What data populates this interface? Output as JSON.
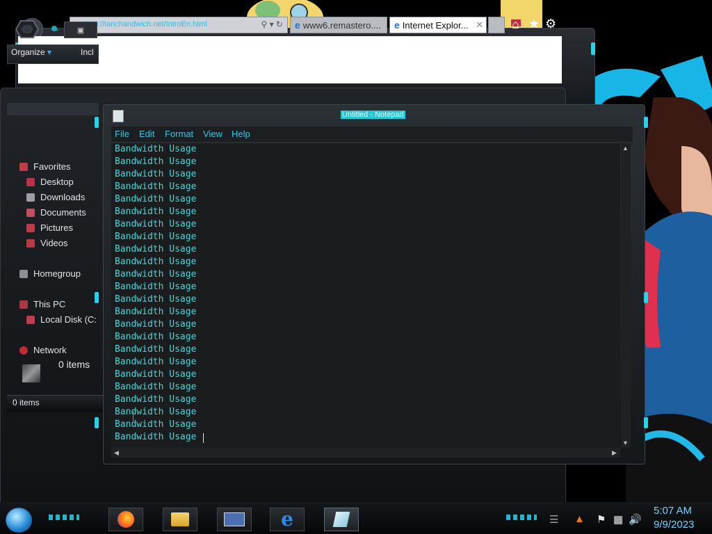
{
  "ie": {
    "url": "http://ianchandwich.net/IntroEn.html",
    "tab1": "www6.remastero....",
    "tab2": "Internet Explor..."
  },
  "explorer": {
    "toolbar": {
      "organize": "Organize",
      "include": "Incl"
    },
    "crumb": "▣",
    "nav": {
      "favorites": "Favorites",
      "desktop": "Desktop",
      "downloads": "Downloads",
      "documents": "Documents",
      "pictures": "Pictures",
      "videos": "Videos",
      "homegroup": "Homegroup",
      "this_pc": "This PC",
      "local_disk": "Local Disk (C:",
      "network": "Network"
    },
    "items_count": "0 items",
    "status_text": "0 items"
  },
  "notepad": {
    "title": "Untitled - Notepad",
    "menu": [
      "File",
      "Edit",
      "Format",
      "View",
      "Help"
    ],
    "lines": [
      "Bandwidth Usage",
      "Bandwidth Usage",
      "Bandwidth Usage",
      "Bandwidth Usage",
      "Bandwidth Usage",
      "Bandwidth Usage",
      "Bandwidth Usage",
      "Bandwidth Usage",
      "Bandwidth Usage",
      "Bandwidth Usage",
      "Bandwidth Usage",
      "Bandwidth Usage",
      "Bandwidth Usage",
      "Bandwidth Usage",
      "Bandwidth Usage",
      "Bandwidth Usage",
      "Bandwidth Usage",
      "Bandwidth Usage",
      "Bandwidth Usage",
      "Bandwidth Usage",
      "Bandwidth Usage",
      "Bandwidth Usage",
      "Bandwidth Usage",
      "Bandwidth Usage"
    ]
  },
  "taskbar": {
    "time": "5:07 AM",
    "date": "9/9/2023",
    "apps": [
      "firefox-icon",
      "file-explorer-icon",
      "control-panel-icon",
      "internet-explorer-icon",
      "notepad-icon"
    ]
  },
  "colors": {
    "accent_cyan": "#27d3ea",
    "notepad_text": "#43d7dd",
    "clock": "#6ed3ff"
  }
}
